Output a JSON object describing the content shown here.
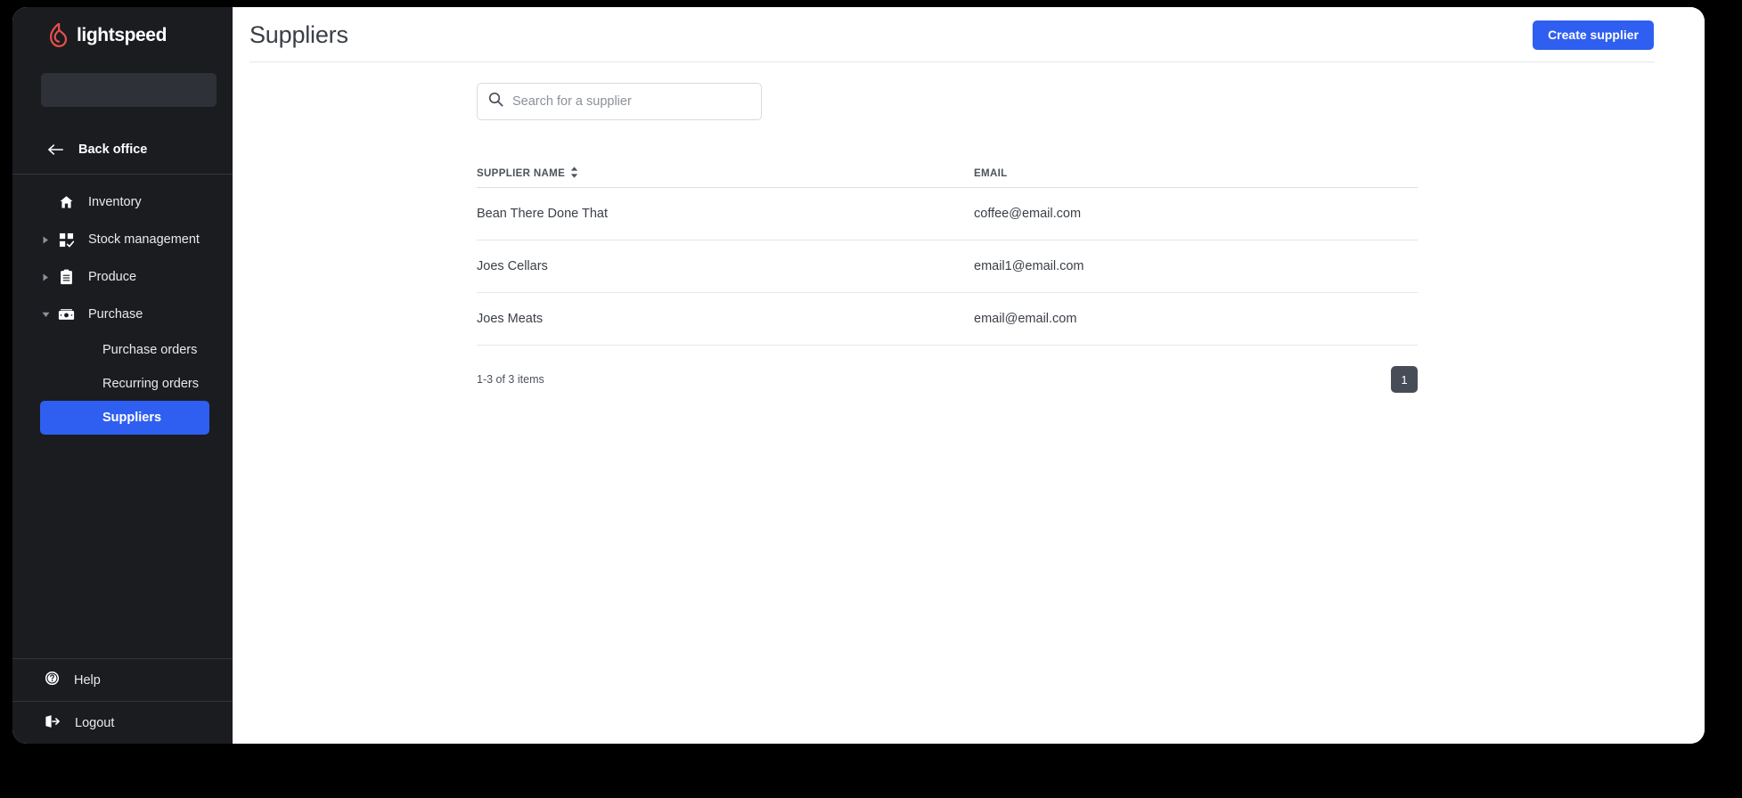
{
  "brand": {
    "name": "lightspeed",
    "logo_icon": "lightspeed-flame-icon",
    "logo_color": "#e8504a"
  },
  "colors": {
    "accent": "#2f5ff0",
    "sidebar_bg": "#1a1c20",
    "page_btn_bg": "#474d57",
    "text_dark": "#3a3f47"
  },
  "sidebar": {
    "back_office_label": "Back office",
    "back_office_icon": "arrow-left-icon",
    "items": [
      {
        "label": "Inventory",
        "icon": "home-icon",
        "caret": "none",
        "expanded": false
      },
      {
        "label": "Stock management",
        "icon": "grid-check-icon",
        "caret": "collapsed",
        "expanded": false
      },
      {
        "label": "Produce",
        "icon": "clipboard-icon",
        "caret": "collapsed",
        "expanded": false
      },
      {
        "label": "Purchase",
        "icon": "cash-icon",
        "caret": "expanded",
        "expanded": true
      }
    ],
    "sub_items": [
      {
        "label": "Purchase orders",
        "active": false
      },
      {
        "label": "Recurring orders",
        "active": false
      },
      {
        "label": "Suppliers",
        "active": true
      }
    ],
    "bottom_items": [
      {
        "label": "Help",
        "icon": "question-circle-icon"
      },
      {
        "label": "Logout",
        "icon": "logout-icon"
      }
    ]
  },
  "header": {
    "title": "Suppliers",
    "create_button_label": "Create supplier"
  },
  "search": {
    "placeholder": "Search for a supplier",
    "value": "",
    "icon": "search-icon"
  },
  "table": {
    "columns": [
      {
        "label": "SUPPLIER NAME",
        "sortable": true,
        "sort_icon": "sort-updown-icon"
      },
      {
        "label": "EMAIL",
        "sortable": false
      }
    ],
    "rows": [
      {
        "supplier_name": "Bean There Done That",
        "email": "coffee@email.com"
      },
      {
        "supplier_name": "Joes Cellars",
        "email": "email1@email.com"
      },
      {
        "supplier_name": "Joes Meats",
        "email": "email@email.com"
      }
    ]
  },
  "pagination": {
    "info": "1-3 of 3 items",
    "current_page": "1"
  }
}
